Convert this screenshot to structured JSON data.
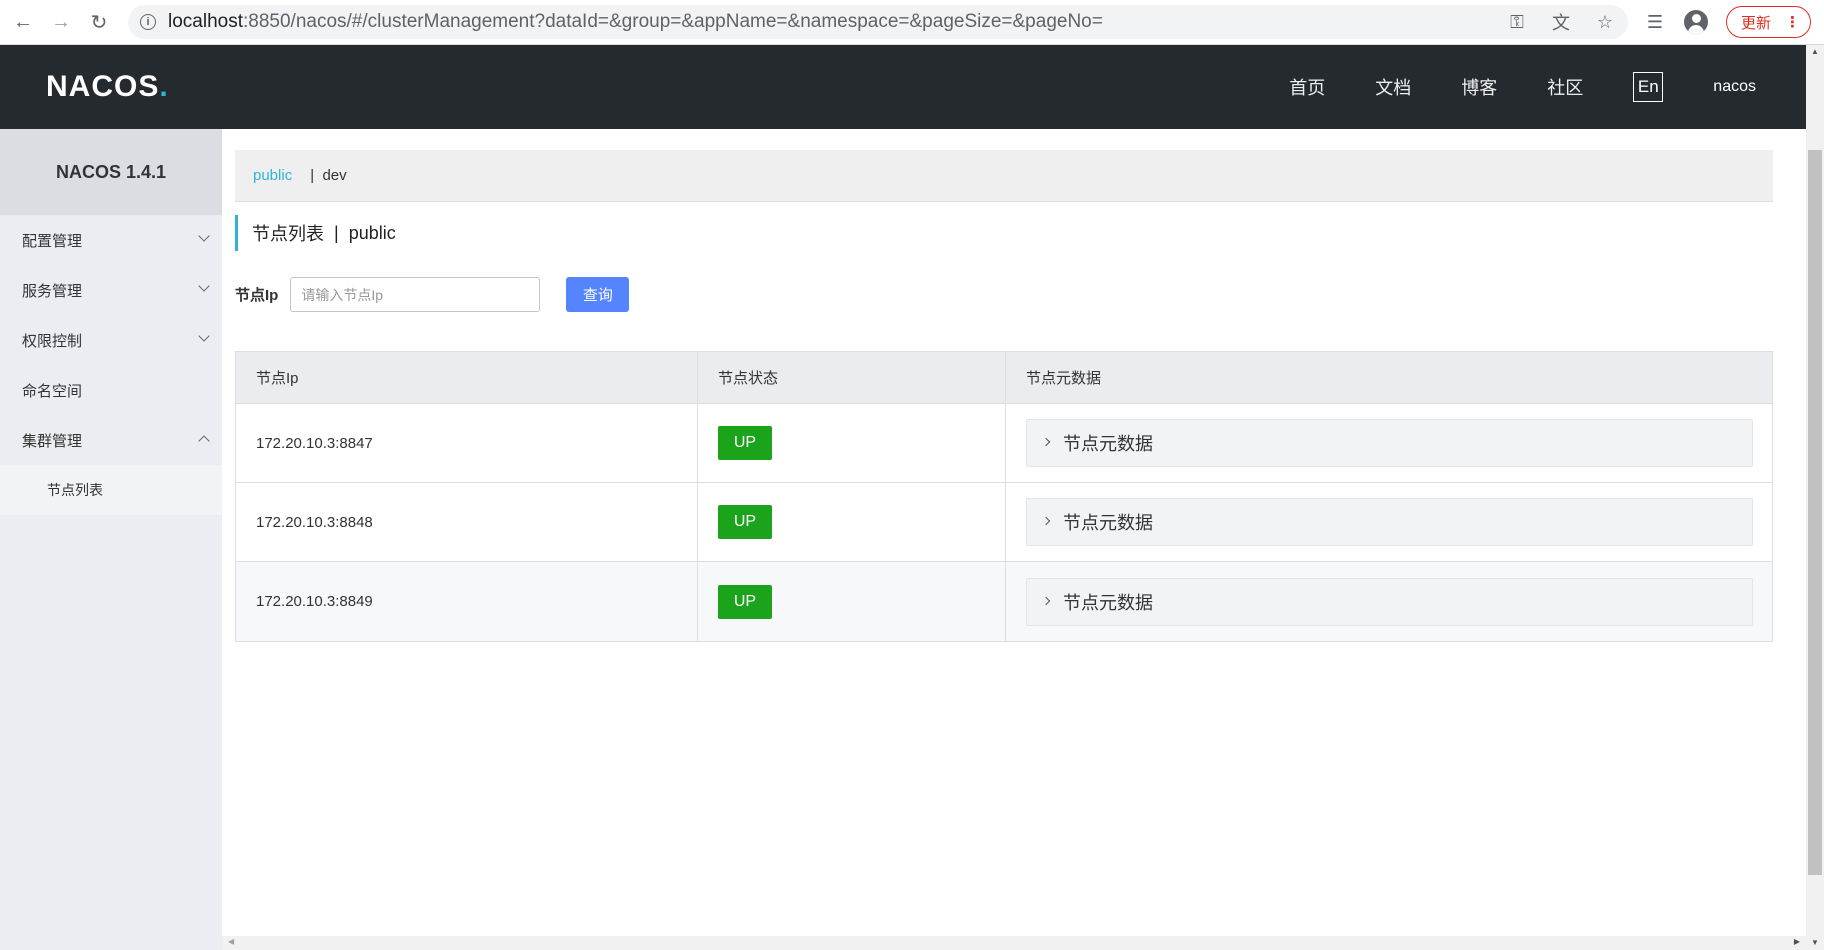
{
  "browser": {
    "url_host": "localhost",
    "url_rest": ":8850/nacos/#/clusterManagement?dataId=&group=&appName=&namespace=&pageSize=&pageNo=",
    "update_label": "更新"
  },
  "header": {
    "logo_text": "NACOS",
    "logo_dot": ".",
    "nav": [
      "首页",
      "文档",
      "博客",
      "社区"
    ],
    "lang": "En",
    "user": "nacos"
  },
  "sidebar": {
    "title": "NACOS 1.4.1",
    "items": [
      {
        "label": "配置管理",
        "expandable": true
      },
      {
        "label": "服务管理",
        "expandable": true
      },
      {
        "label": "权限控制",
        "expandable": true
      },
      {
        "label": "命名空间",
        "expandable": false
      },
      {
        "label": "集群管理",
        "expandable": true,
        "expanded": true
      }
    ],
    "sub_items": [
      "节点列表"
    ]
  },
  "namespaces": {
    "active": "public",
    "others": [
      "dev"
    ]
  },
  "page": {
    "title": "节点列表",
    "namespace": "public"
  },
  "filter": {
    "label": "节点Ip",
    "placeholder": "请输入节点Ip",
    "value": "",
    "query_label": "查询"
  },
  "table": {
    "headers": [
      "节点Ip",
      "节点状态",
      "节点元数据"
    ],
    "rows": [
      {
        "ip": "172.20.10.3:8847",
        "status": "UP",
        "meta": "节点元数据"
      },
      {
        "ip": "172.20.10.3:8848",
        "status": "UP",
        "meta": "节点元数据"
      },
      {
        "ip": "172.20.10.3:8849",
        "status": "UP",
        "meta": "节点元数据"
      }
    ]
  },
  "colors": {
    "accent": "#2fb3d8",
    "header_bg": "#252a2f",
    "status_up": "#1ba31b",
    "primary_button": "#5584ff"
  }
}
